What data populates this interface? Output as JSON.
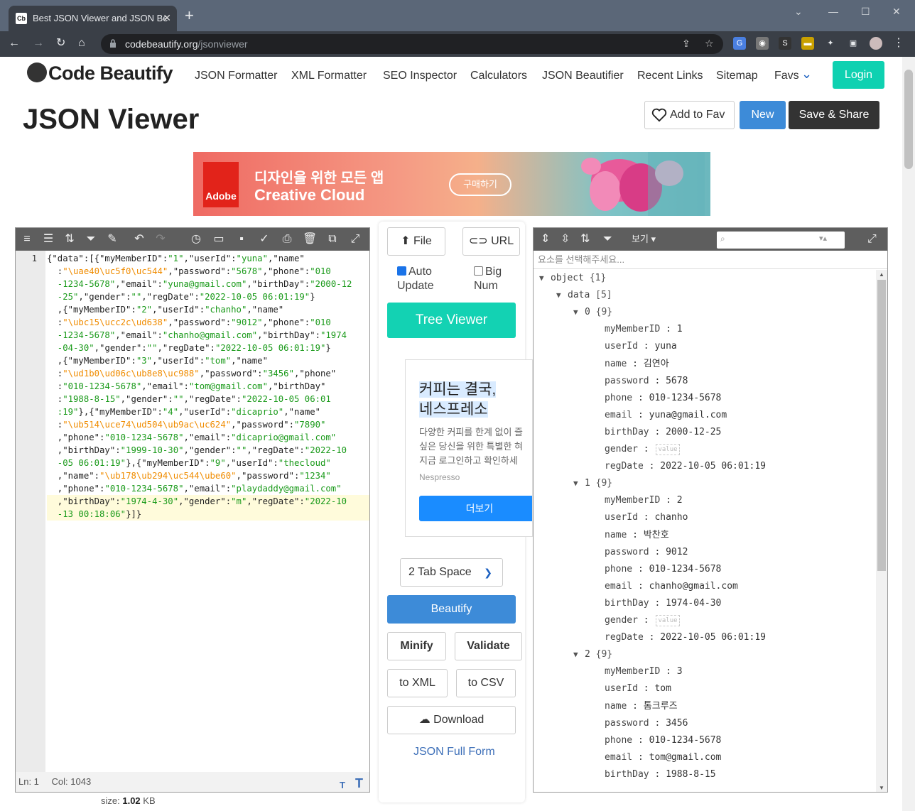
{
  "browser": {
    "tab_title": "Best JSON Viewer and JSON Be",
    "favicon_text": "Cb",
    "url_host": "codebeautify.org",
    "url_path": "/jsonviewer"
  },
  "site": {
    "brand": "Code Beautify",
    "nav": [
      "JSON Formatter",
      "XML Formatter",
      "SEO Inspector",
      "Calculators",
      "JSON Beautifier",
      "Recent Links",
      "Sitemap",
      "Favs"
    ],
    "login": "Login",
    "page_title": "JSON Viewer",
    "add_to_fav": "Add to Fav",
    "new": "New",
    "save_share": "Save & Share"
  },
  "ad": {
    "brand": "Adobe",
    "line1": "디자인을 위한 모든 앱",
    "line2": "Creative Cloud",
    "cta": "구매하기"
  },
  "editor": {
    "line_number": "1",
    "status_ln": "Ln: 1",
    "status_col": "Col: 1043",
    "size_label": "size:",
    "size_value": "1.02",
    "size_unit": "KB"
  },
  "middle": {
    "file": "File",
    "url": "URL",
    "auto_update": "Auto Update",
    "auto_update_checked": true,
    "big_num": "Big Num",
    "big_num_checked": false,
    "tree_viewer": "Tree Viewer",
    "tab_space": "2 Tab Space",
    "beautify": "Beautify",
    "minify": "Minify",
    "validate": "Validate",
    "to_xml": "to XML",
    "to_csv": "to CSV",
    "download": "Download",
    "full_form": "JSON Full Form"
  },
  "ad2": {
    "title1": "커피는 결국,",
    "title2": "네스프레소",
    "body1": "다양한 커피를 한계 없이 즐",
    "body2": "싶은 당신을 위한 특별한 혀",
    "body3": "지금 로그인하고 확인하세",
    "advertiser": "Nespresso",
    "cta": "더보기"
  },
  "tree_viewer": {
    "view_menu": "보기 ▾",
    "path_placeholder": "요소를 선택해주세요...",
    "root": "object",
    "root_count": "{1}",
    "data_key": "data",
    "data_count": "[5]",
    "empty_value": "value",
    "items": [
      {
        "index": "0",
        "count": "{9}",
        "myMemberID": "1",
        "userId": "yuna",
        "name": "김연아",
        "password": "5678",
        "phone": "010-1234-5678",
        "email": "yuna@gmail.com",
        "birthDay": "2000-12-25",
        "gender": "",
        "regDate": "2022-10-05 06:01:19"
      },
      {
        "index": "1",
        "count": "{9}",
        "myMemberID": "2",
        "userId": "chanho",
        "name": "박찬호",
        "password": "9012",
        "phone": "010-1234-5678",
        "email": "chanho@gmail.com",
        "birthDay": "1974-04-30",
        "gender": "",
        "regDate": "2022-10-05 06:01:19"
      },
      {
        "index": "2",
        "count": "{9}",
        "myMemberID": "3",
        "userId": "tom",
        "name": "톰크루즈",
        "password": "3456",
        "phone": "010-1234-5678",
        "email": "tom@gmail.com",
        "birthDay": "1988-8-15"
      }
    ]
  },
  "code_lines": [
    [
      [
        "p",
        "{\"data\":[{\"myMemberID\":"
      ],
      [
        "s",
        "\"1\""
      ],
      [
        "p",
        ",\"userId\":"
      ],
      [
        "s",
        "\"yuna\""
      ],
      [
        "p",
        ",\"name\""
      ]
    ],
    [
      [
        "p",
        "  :"
      ],
      [
        "u",
        "\"\\uae40\\uc5f0\\uc544\""
      ],
      [
        "p",
        ",\"password\":"
      ],
      [
        "s",
        "\"5678\""
      ],
      [
        "p",
        ",\"phone\":"
      ],
      [
        "s",
        "\"010"
      ]
    ],
    [
      [
        "s",
        "  -1234-5678\""
      ],
      [
        "p",
        ",\"email\":"
      ],
      [
        "s",
        "\"yuna@gmail.com\""
      ],
      [
        "p",
        ",\"birthDay\":"
      ],
      [
        "s",
        "\"2000-12"
      ]
    ],
    [
      [
        "s",
        "  -25\""
      ],
      [
        "p",
        ",\"gender\":"
      ],
      [
        "s",
        "\"\""
      ],
      [
        "p",
        ",\"regDate\":"
      ],
      [
        "s",
        "\"2022-10-05 06:01:19\""
      ],
      [
        "p",
        "}"
      ]
    ],
    [
      [
        "p",
        "  ,{\"myMemberID\":"
      ],
      [
        "s",
        "\"2\""
      ],
      [
        "p",
        ",\"userId\":"
      ],
      [
        "s",
        "\"chanho\""
      ],
      [
        "p",
        ",\"name\""
      ]
    ],
    [
      [
        "p",
        "  :"
      ],
      [
        "u",
        "\"\\ubc15\\ucc2c\\ud638\""
      ],
      [
        "p",
        ",\"password\":"
      ],
      [
        "s",
        "\"9012\""
      ],
      [
        "p",
        ",\"phone\":"
      ],
      [
        "s",
        "\"010"
      ]
    ],
    [
      [
        "s",
        "  -1234-5678\""
      ],
      [
        "p",
        ",\"email\":"
      ],
      [
        "s",
        "\"chanho@gmail.com\""
      ],
      [
        "p",
        ",\"birthDay\":"
      ],
      [
        "s",
        "\"1974"
      ]
    ],
    [
      [
        "s",
        "  -04-30\""
      ],
      [
        "p",
        ",\"gender\":"
      ],
      [
        "s",
        "\"\""
      ],
      [
        "p",
        ",\"regDate\":"
      ],
      [
        "s",
        "\"2022-10-05 06:01:19\""
      ],
      [
        "p",
        "}"
      ]
    ],
    [
      [
        "p",
        "  ,{\"myMemberID\":"
      ],
      [
        "s",
        "\"3\""
      ],
      [
        "p",
        ",\"userId\":"
      ],
      [
        "s",
        "\"tom\""
      ],
      [
        "p",
        ",\"name\""
      ]
    ],
    [
      [
        "p",
        "  :"
      ],
      [
        "u",
        "\"\\ud1b0\\ud06c\\ub8e8\\uc988\""
      ],
      [
        "p",
        ",\"password\":"
      ],
      [
        "s",
        "\"3456\""
      ],
      [
        "p",
        ",\"phone\""
      ]
    ],
    [
      [
        "p",
        "  :"
      ],
      [
        "s",
        "\"010-1234-5678\""
      ],
      [
        "p",
        ",\"email\":"
      ],
      [
        "s",
        "\"tom@gmail.com\""
      ],
      [
        "p",
        ",\"birthDay\""
      ]
    ],
    [
      [
        "p",
        "  :"
      ],
      [
        "s",
        "\"1988-8-15\""
      ],
      [
        "p",
        ",\"gender\":"
      ],
      [
        "s",
        "\"\""
      ],
      [
        "p",
        ",\"regDate\":"
      ],
      [
        "s",
        "\"2022-10-05 06:01"
      ]
    ],
    [
      [
        "s",
        "  :19\""
      ],
      [
        "p",
        "},{\"myMemberID\":"
      ],
      [
        "s",
        "\"4\""
      ],
      [
        "p",
        ",\"userId\":"
      ],
      [
        "s",
        "\"dicaprio\""
      ],
      [
        "p",
        ",\"name\""
      ]
    ],
    [
      [
        "p",
        "  :"
      ],
      [
        "u",
        "\"\\ub514\\uce74\\ud504\\ub9ac\\uc624\""
      ],
      [
        "p",
        ",\"password\":"
      ],
      [
        "s",
        "\"7890\""
      ]
    ],
    [
      [
        "p",
        "  ,\"phone\":"
      ],
      [
        "s",
        "\"010-1234-5678\""
      ],
      [
        "p",
        ",\"email\":"
      ],
      [
        "s",
        "\"dicaprio@gmail.com\""
      ]
    ],
    [
      [
        "p",
        "  ,\"birthDay\":"
      ],
      [
        "s",
        "\"1999-10-30\""
      ],
      [
        "p",
        ",\"gender\":"
      ],
      [
        "s",
        "\"\""
      ],
      [
        "p",
        ",\"regDate\":"
      ],
      [
        "s",
        "\"2022-10"
      ]
    ],
    [
      [
        "s",
        "  -05 06:01:19\""
      ],
      [
        "p",
        "},{\"myMemberID\":"
      ],
      [
        "s",
        "\"9\""
      ],
      [
        "p",
        ",\"userId\":"
      ],
      [
        "s",
        "\"thecloud\""
      ]
    ],
    [
      [
        "p",
        "  ,\"name\":"
      ],
      [
        "u",
        "\"\\ub178\\ub294\\uc544\\ube60\""
      ],
      [
        "p",
        ",\"password\":"
      ],
      [
        "s",
        "\"1234\""
      ]
    ],
    [
      [
        "p",
        "  ,\"phone\":"
      ],
      [
        "s",
        "\"010-1234-5678\""
      ],
      [
        "p",
        ",\"email\":"
      ],
      [
        "s",
        "\"playdaddy@gmail.com\""
      ]
    ],
    [
      [
        "p",
        "  ,\"birthDay\":"
      ],
      [
        "s",
        "\"1974-4-30\""
      ],
      [
        "p",
        ",\"gender\":"
      ],
      [
        "s",
        "\"m\""
      ],
      [
        "p",
        ",\"regDate\":"
      ],
      [
        "s",
        "\"2022-10"
      ]
    ],
    [
      [
        "s",
        "  -13 00:18:06\""
      ],
      [
        "p",
        "}]}"
      ]
    ]
  ]
}
